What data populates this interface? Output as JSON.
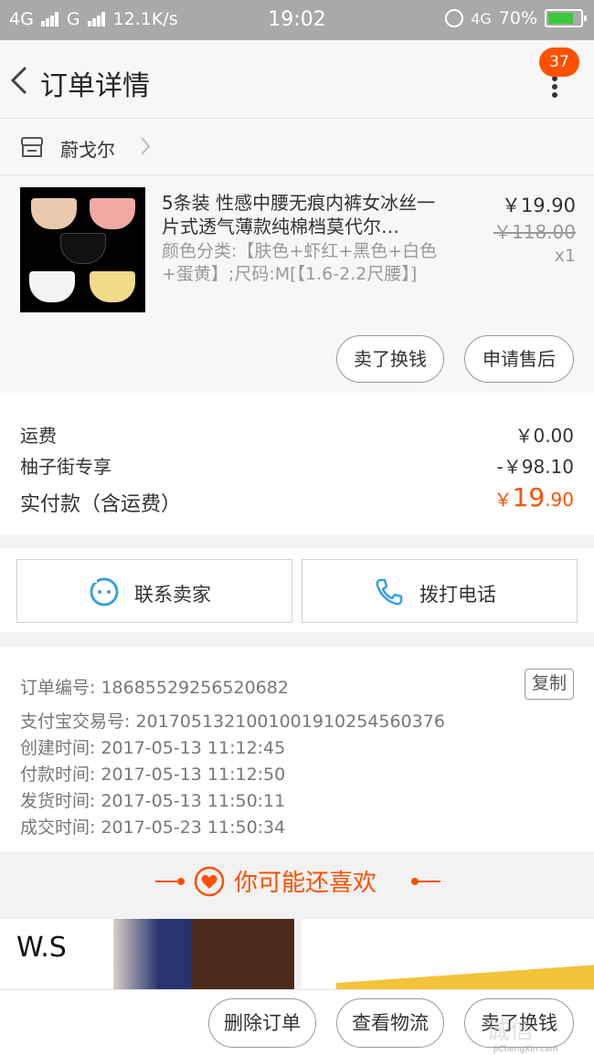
{
  "status_bar": {
    "network1": "4G",
    "network2": "G",
    "speed": "12.1K/s",
    "time": "19:02",
    "network3": "4G",
    "battery": "70%",
    "battery_level": 0.7
  },
  "header": {
    "title": "订单详情",
    "message_count": "37"
  },
  "shop": {
    "name": "蔚戈尔"
  },
  "item": {
    "title": "5条装 性感中腰无痕内裤女冰丝一片式透气薄款纯棉档莫代尔…",
    "sku": "颜色分类:【肤色+虾红+黑色+白色+蛋黄】;尺码:M[【1.6-2.2尺腰】]",
    "price": "￥19.90",
    "original_price": "￥118.00",
    "quantity": "x1",
    "btn_trade_in": "卖了换钱",
    "btn_after_sale": "申请售后",
    "thumb_colors": [
      "#e8c9ad",
      "#f1a9a4",
      "#111111",
      "#f4f4f4",
      "#f3d98a"
    ]
  },
  "costs": {
    "shipping_label": "运费",
    "shipping_value": "￥0.00",
    "discount_label": "柚子街专享",
    "discount_value": "-￥98.10",
    "paid_label": "实付款（含运费）",
    "paid_currency": "￥",
    "paid_int": "19",
    "paid_dec": ".90"
  },
  "contact": {
    "seller": "联系卖家",
    "phone": "拨打电话"
  },
  "order_info": {
    "order_no": "订单编号: 1868552925652068​2",
    "copy": "复制",
    "alipay_no": "支付宝交易号: 2017051321001001910254560376",
    "created": "创建时间: 2017-05-13 11:12:45",
    "paid": "付款时间: 2017-05-13 11:12:50",
    "shipped": "发货时间: 2017-05-13 11:50:11",
    "completed": "成交时间: 2017-05-23 11:50:34"
  },
  "recommend": {
    "title": "你可能还喜欢",
    "card1_text": "W.S"
  },
  "bottom_bar": {
    "delete": "删除订单",
    "logistics": "查看物流",
    "trade_in": "卖了换钱"
  },
  "watermark": {
    "text": "诚信",
    "domain": "JiChengXin.com"
  },
  "colors": {
    "accent": "#ff5000",
    "status_bar": "#a9a9a9",
    "contact_icon": "#3aa0e0"
  }
}
